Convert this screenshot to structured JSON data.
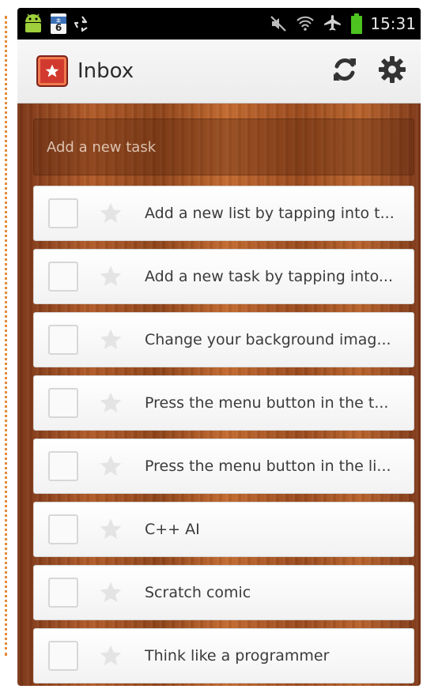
{
  "status_bar": {
    "calendar_day": "6",
    "time": "15:31",
    "icons": [
      "android-icon",
      "calendar-icon",
      "recycle-icon",
      "mute-icon",
      "wifi-icon",
      "airplane-icon",
      "battery-icon"
    ]
  },
  "action_bar": {
    "title": "Inbox",
    "actions": [
      "sync-icon",
      "settings-gear-icon"
    ]
  },
  "add_task": {
    "placeholder": "Add a new task"
  },
  "tasks": [
    {
      "text": "Add a new list by tapping into t...",
      "starred": false,
      "done": false
    },
    {
      "text": "Add a new task by tapping into...",
      "starred": false,
      "done": false
    },
    {
      "text": "Change your background imag...",
      "starred": false,
      "done": false
    },
    {
      "text": "Press the menu button in the t...",
      "starred": false,
      "done": false
    },
    {
      "text": "Press the menu button in the li...",
      "starred": false,
      "done": false
    },
    {
      "text": "C++ AI",
      "starred": false,
      "done": false
    },
    {
      "text": "Scratch comic",
      "starred": false,
      "done": false
    },
    {
      "text": "Think like a programmer",
      "starred": false,
      "done": false
    }
  ],
  "colors": {
    "accent_red": "#d23a2f",
    "wood": "#a8532a",
    "battery_green": "#4cc31f"
  }
}
